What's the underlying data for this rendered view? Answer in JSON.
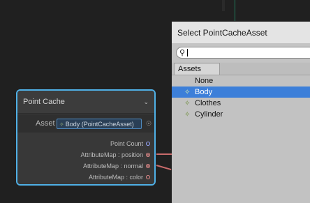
{
  "node": {
    "title": "Point Cache",
    "asset_label": "Asset",
    "asset_value": "Body (PointCacheAsset)",
    "ports": [
      {
        "label": "Point Count"
      },
      {
        "label": "AttributeMap : position"
      },
      {
        "label": "AttributeMap : normal"
      },
      {
        "label": "AttributeMap : color"
      }
    ]
  },
  "dialog": {
    "title": "Select PointCacheAsset",
    "search": {
      "value": ""
    },
    "tab_assets": "Assets",
    "items": [
      {
        "label": "None",
        "has_icon": false,
        "selected": false
      },
      {
        "label": "Body",
        "has_icon": true,
        "selected": true
      },
      {
        "label": "Clothes",
        "has_icon": true,
        "selected": false
      },
      {
        "label": "Cylinder",
        "has_icon": true,
        "selected": false
      }
    ]
  },
  "icons": [
    "search-icon",
    "chevron-down-icon",
    "object-picker-icon",
    "pointcache-asset-icon"
  ],
  "colors": {
    "selection": "#3c7fd9",
    "node_border": "#4fb0e6",
    "edge": "#c96b6b"
  }
}
